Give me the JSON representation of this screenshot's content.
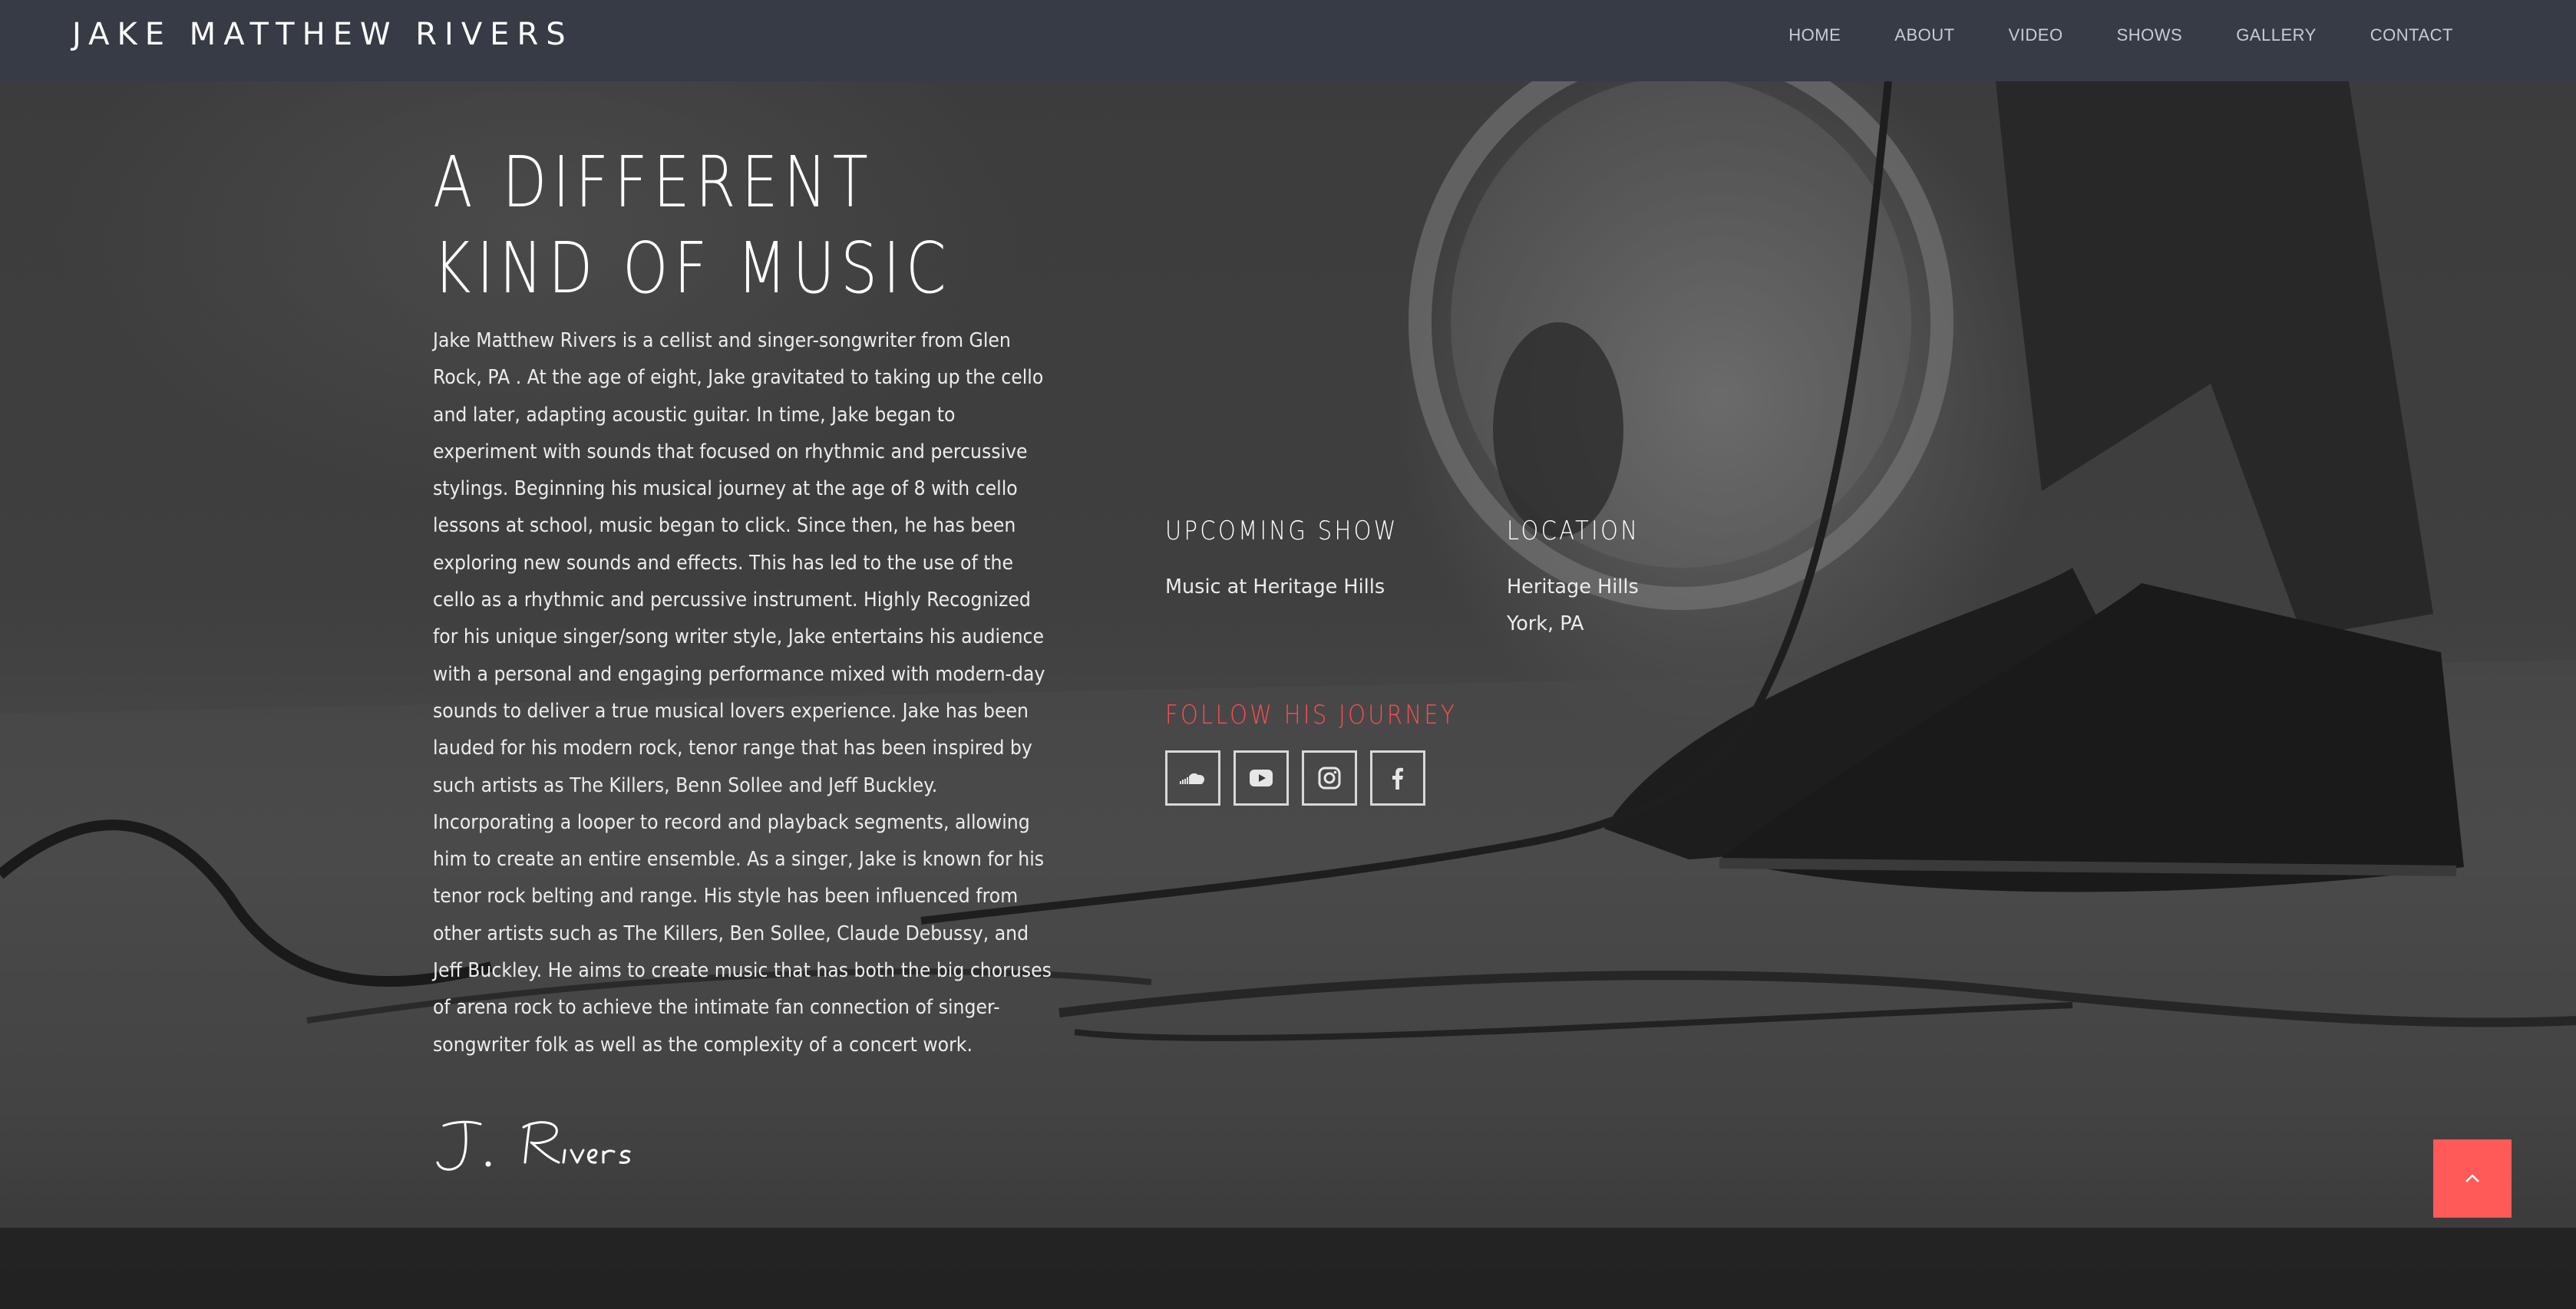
{
  "site": {
    "brand": "JAKE MATTHEW RIVERS"
  },
  "nav": {
    "items": [
      {
        "label": "HOME"
      },
      {
        "label": "ABOUT"
      },
      {
        "label": "VIDEO"
      },
      {
        "label": "SHOWS"
      },
      {
        "label": "GALLERY"
      },
      {
        "label": "CONTACT"
      }
    ]
  },
  "hero": {
    "headline_line1": "A DIFFERENT",
    "headline_line2": "KIND OF MUSIC",
    "bio_lines": [
      "Jake Matthew Rivers is a cellist and singer-songwriter from Glen",
      "Rock, PA . At the age of eight, Jake gravitated to taking up the cello",
      "and later, adapting acoustic guitar. In time, Jake began to",
      "experiment with sounds that focused on rhythmic and percussive",
      "stylings. Beginning his musical journey at the age of 8 with cello",
      "lessons at school, music began to click. Since then, he has been",
      "exploring new sounds and effects. This has led to the use of the",
      "cello as a rhythmic and percussive instrument. Highly Recognized",
      "for his unique singer/song writer style, Jake entertains his audience",
      "with a personal and engaging performance mixed with modern-day",
      "sounds to deliver a true musical lovers experience. Jake has been",
      "lauded for his modern rock, tenor range that has been inspired by",
      "such artists as The Killers, Benn Sollee and Jeff Buckley.",
      "Incorporating a looper to record and playback segments, allowing",
      "him to create an entire ensemble. As a singer, Jake is known for his",
      "tenor rock belting and range. His style has been influenced from",
      "other artists such as The Killers, Ben Sollee, Claude Debussy, and",
      "Jeff Buckley. He aims to create music that has both the big choruses",
      "of arena rock to achieve the intimate fan connection of singer-",
      "songwriter folk as well as the complexity of a concert work."
    ],
    "signature": "J. Rivers"
  },
  "upcoming_show": {
    "heading": "UPCOMING SHOW",
    "name": "Music at Heritage Hills"
  },
  "location": {
    "heading": "LOCATION",
    "line1": "Heritage Hills",
    "line2": "York, PA"
  },
  "follow": {
    "heading": "FOLLOW HIS JOURNEY",
    "icons": [
      "soundcloud-icon",
      "youtube-icon",
      "instagram-icon",
      "facebook-icon"
    ]
  },
  "colors": {
    "navbar_bg": "#363b45",
    "accent_red": "#ff5a57",
    "follow_heading": "#ff4b52"
  }
}
